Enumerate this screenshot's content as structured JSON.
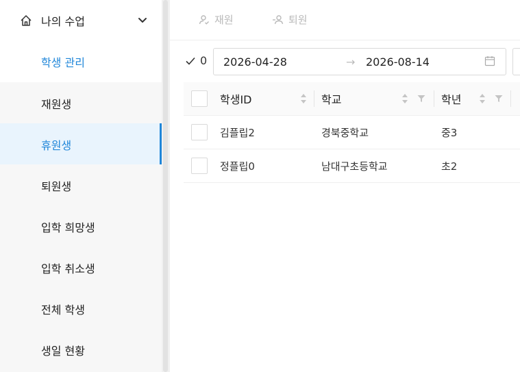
{
  "sidebar": {
    "groups": [
      {
        "label": "나의 수업",
        "icon": "home-icon",
        "expanded": false
      },
      {
        "label": "학생 관리",
        "icon": "id-card-icon",
        "expanded": true
      }
    ],
    "items": [
      {
        "label": "재원생",
        "active": false
      },
      {
        "label": "휴원생",
        "active": true
      },
      {
        "label": "퇴원생",
        "active": false
      },
      {
        "label": "입학 희망생",
        "active": false
      },
      {
        "label": "입학 취소생",
        "active": false
      },
      {
        "label": "전체 학생",
        "active": false
      },
      {
        "label": "생일 현황",
        "active": false
      }
    ]
  },
  "toolbar": {
    "enroll_label": "재원",
    "withdraw_label": "퇴원"
  },
  "filter": {
    "selected_count": "0",
    "date_from": "2026-04-28",
    "date_to": "2026-08-14",
    "arrow": "→"
  },
  "table": {
    "columns": [
      "학생ID",
      "학교",
      "학년"
    ],
    "rows": [
      [
        "김플립2",
        "경북중학교",
        "중3"
      ],
      [
        "정플립0",
        "남대구초등학교",
        "초2"
      ]
    ]
  },
  "colors": {
    "accent": "#1f86d9",
    "active_bg": "#e9f4fd",
    "submenu_bg": "#f7f7f7",
    "disabled_text": "#b9b9b9"
  }
}
